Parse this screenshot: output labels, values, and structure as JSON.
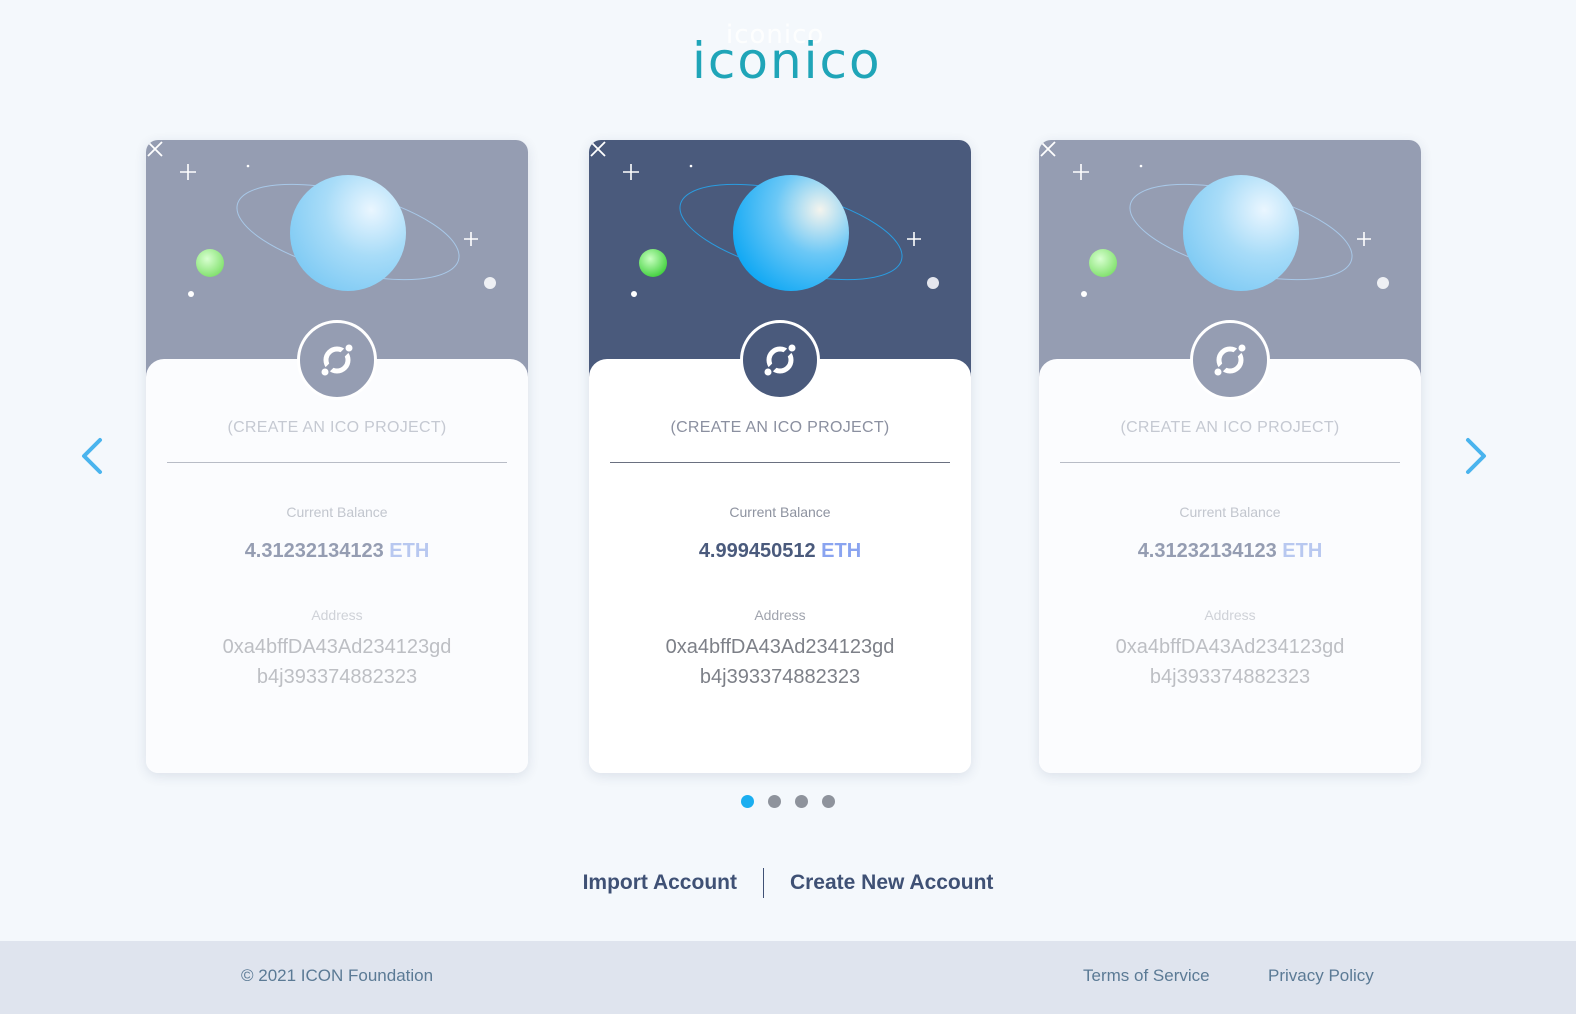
{
  "header": {
    "logo_text": "iconico",
    "logo_ghost_text": "iconico"
  },
  "cards": [
    {
      "state": "dimmed",
      "project": "(CREATE AN ICO PROJECT)",
      "balance_label": "Current Balance",
      "balance_value": "4.31232134123",
      "balance_unit": "ETH",
      "address_label": "Address",
      "address_line1": "0xa4bffDA43Ad234123gd",
      "address_line2": "b4j393374882323"
    },
    {
      "state": "active",
      "project": "(CREATE AN ICO PROJECT)",
      "balance_label": "Current Balance",
      "balance_value": "4.999450512",
      "balance_unit": "ETH",
      "address_label": "Address",
      "address_line1": "0xa4bffDA43Ad234123gd",
      "address_line2": "b4j393374882323"
    },
    {
      "state": "dimmed",
      "project": "(CREATE AN ICO PROJECT)",
      "balance_label": "Current Balance",
      "balance_value": "4.31232134123",
      "balance_unit": "ETH",
      "address_label": "Address",
      "address_line1": "0xa4bffDA43Ad234123gd",
      "address_line2": "b4j393374882323"
    }
  ],
  "carousel": {
    "page_count": 4,
    "active_page": 1
  },
  "actions": {
    "import_label": "Import Account",
    "create_label": "Create New Account"
  },
  "footer": {
    "copyright": "© 2021 ICON Foundation",
    "terms_label": "Terms of Service",
    "privacy_label": "Privacy Policy"
  },
  "colors": {
    "brand": "#1fa5b8",
    "accent": "#1aaef0",
    "card_active": "#4a5a7c",
    "card_dimmed": "#959db2",
    "footer_bg": "#dfe4ee"
  },
  "icons": [
    "close-icon",
    "icon-logo-icon",
    "chevron-left-icon",
    "chevron-right-icon",
    "planet-illustration"
  ]
}
